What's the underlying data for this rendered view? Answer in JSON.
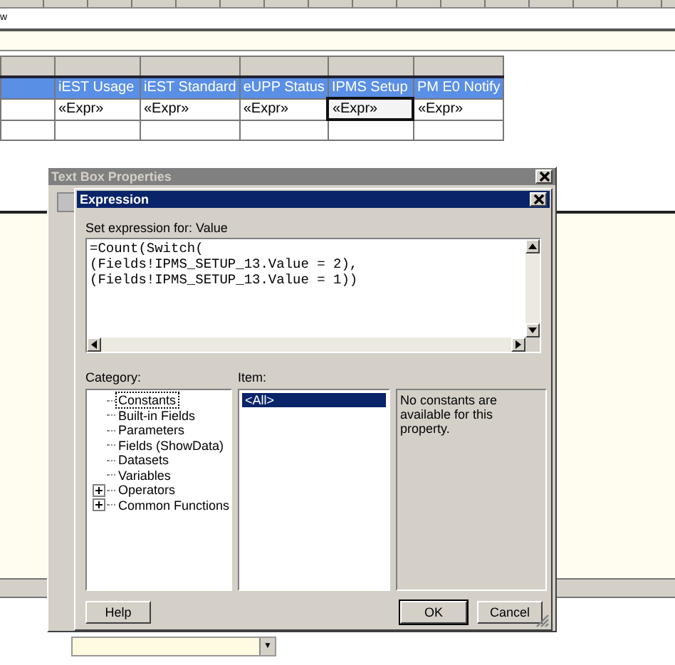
{
  "report": {
    "cut_text": "w",
    "table": {
      "header_cells": [
        "",
        "iEST Usage",
        "iEST Standard",
        "eUPP Status",
        "IPMS Setup",
        "PM E0 Notify"
      ],
      "rows": [
        {
          "cells": [
            {
              "text": "",
              "selected": false
            },
            {
              "text": "«Expr»",
              "selected": false
            },
            {
              "text": "«Expr»",
              "selected": false
            },
            {
              "text": "«Expr»",
              "selected": false
            },
            {
              "text": "«Expr»",
              "selected": true
            },
            {
              "text": "«Expr»",
              "selected": false
            }
          ]
        },
        {
          "cells": [
            {
              "text": "",
              "selected": false
            },
            {
              "text": "",
              "selected": false
            },
            {
              "text": "",
              "selected": false
            },
            {
              "text": "",
              "selected": false
            },
            {
              "text": "",
              "selected": false
            },
            {
              "text": "",
              "selected": false
            }
          ]
        }
      ]
    }
  },
  "properties_dialog": {
    "title": "Text Box Properties",
    "active": false
  },
  "expression_dialog": {
    "title": "Expression",
    "active": true,
    "prompt": "Set expression for: Value",
    "expression": "=Count(Switch(\n(Fields!IPMS_SETUP_13.Value = 2),\n(Fields!IPMS_SETUP_13.Value = 1))",
    "category_label": "Category:",
    "categories": [
      {
        "label": "Constants",
        "kind": "leaf",
        "selected": true
      },
      {
        "label": "Built-in Fields",
        "kind": "leaf",
        "selected": false
      },
      {
        "label": "Parameters",
        "kind": "leaf",
        "selected": false
      },
      {
        "label": "Fields (ShowData)",
        "kind": "leaf",
        "selected": false
      },
      {
        "label": "Datasets",
        "kind": "leaf",
        "selected": false
      },
      {
        "label": "Variables",
        "kind": "leaf",
        "selected": false
      },
      {
        "label": "Operators",
        "kind": "group",
        "expanded": false,
        "selected": false
      },
      {
        "label": "Common Functions",
        "kind": "group",
        "expanded": false,
        "selected": false
      }
    ],
    "item_label": "Item:",
    "items": [
      {
        "label": "<All>",
        "selected": true
      }
    ],
    "description": "No constants are available for this property.",
    "buttons": [
      {
        "label": "Help",
        "default": false
      },
      {
        "label": "OK",
        "default": true
      },
      {
        "label": "Cancel",
        "default": false
      }
    ]
  },
  "bottom_field": {
    "arrow": "▼"
  }
}
